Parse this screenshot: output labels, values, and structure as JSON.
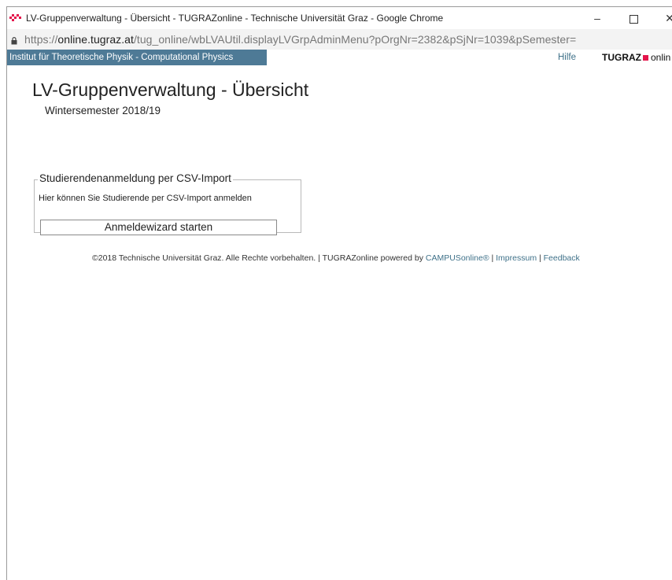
{
  "window": {
    "title": "LV-Gruppenverwaltung - Übersicht - TUGRAZonline - Technische Universität Graz - Google Chrome",
    "minimize_glyph": "–",
    "close_glyph": "✕"
  },
  "address": {
    "scheme": "https://",
    "host": "online.tugraz.at",
    "path": "/tug_online/wbLVAUtil.displayLVGrpAdminMenu?pOrgNr=2382&pSjNr=1039&pSemester="
  },
  "org_bar": {
    "org_name": "Institut für Theoretische Physik - Computational Physics",
    "help_link": "Hilfe",
    "brand_left": "TUGRAZ",
    "brand_right": "onlin",
    "brand_color": "#e4154b",
    "bar_color": "#4e7a96"
  },
  "main": {
    "title": "LV-Gruppenverwaltung - Übersicht",
    "semester": "Wintersemester 2018/19",
    "csv_section": {
      "legend": "Studierendenanmeldung per CSV-Import",
      "description": "Hier können Sie Studierende per CSV-Import anmelden",
      "button_label": "Anmeldewizard starten"
    }
  },
  "footer": {
    "copyright": "©2018 Technische Universität Graz. Alle Rechte vorbehalten. | TUGRAZonline powered by ",
    "campus_link": "CAMPUSonline®",
    "sep1": " | ",
    "impressum_link": "Impressum",
    "sep2": " | ",
    "feedback_link": "Feedback"
  },
  "icons": {
    "app": "tugraz-logo-icon",
    "lock": "lock-icon"
  }
}
